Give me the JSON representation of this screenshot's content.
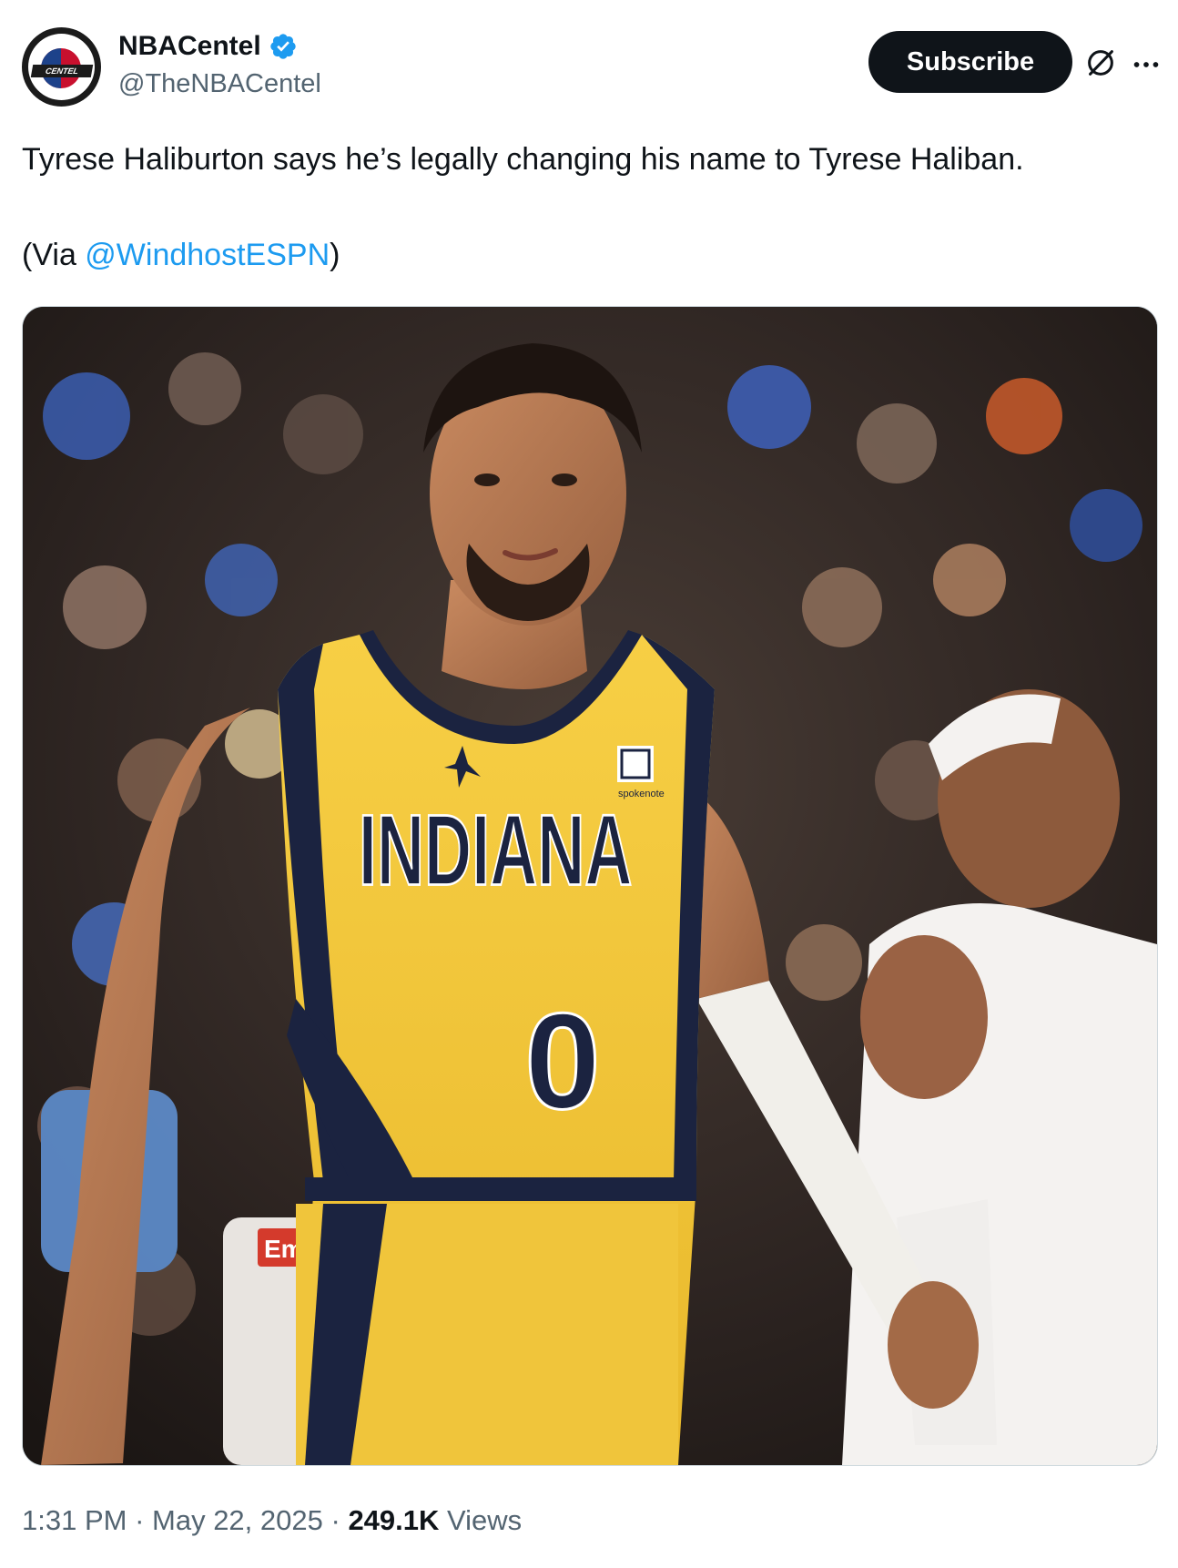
{
  "author": {
    "display_name": "NBACentel",
    "handle": "@TheNBACentel",
    "verified": true,
    "avatar_text": "CENTEL"
  },
  "actions": {
    "subscribe_label": "Subscribe",
    "grok_icon": "grok-icon",
    "more_icon": "more-icon"
  },
  "tweet": {
    "text": "Tyrese Haliburton says he’s legally changing his name to Tyrese Haliban.",
    "via_prefix": "(Via ",
    "via_mention": "@WindhostESPN",
    "via_suffix": ")"
  },
  "media": {
    "jersey_text": "INDIANA",
    "jersey_number": "0",
    "sponsor_text": "spokenote",
    "referee_patch": "Em"
  },
  "meta": {
    "time": "1:31 PM",
    "separator": " · ",
    "date": "May 22, 2025",
    "views_count": "249.1K",
    "views_label": " Views"
  },
  "colors": {
    "link": "#1d9bf0",
    "secondary_text": "#536471",
    "verified": "#1d9bf0",
    "jersey_yellow": "#f5c83a",
    "jersey_navy": "#1b2340"
  }
}
